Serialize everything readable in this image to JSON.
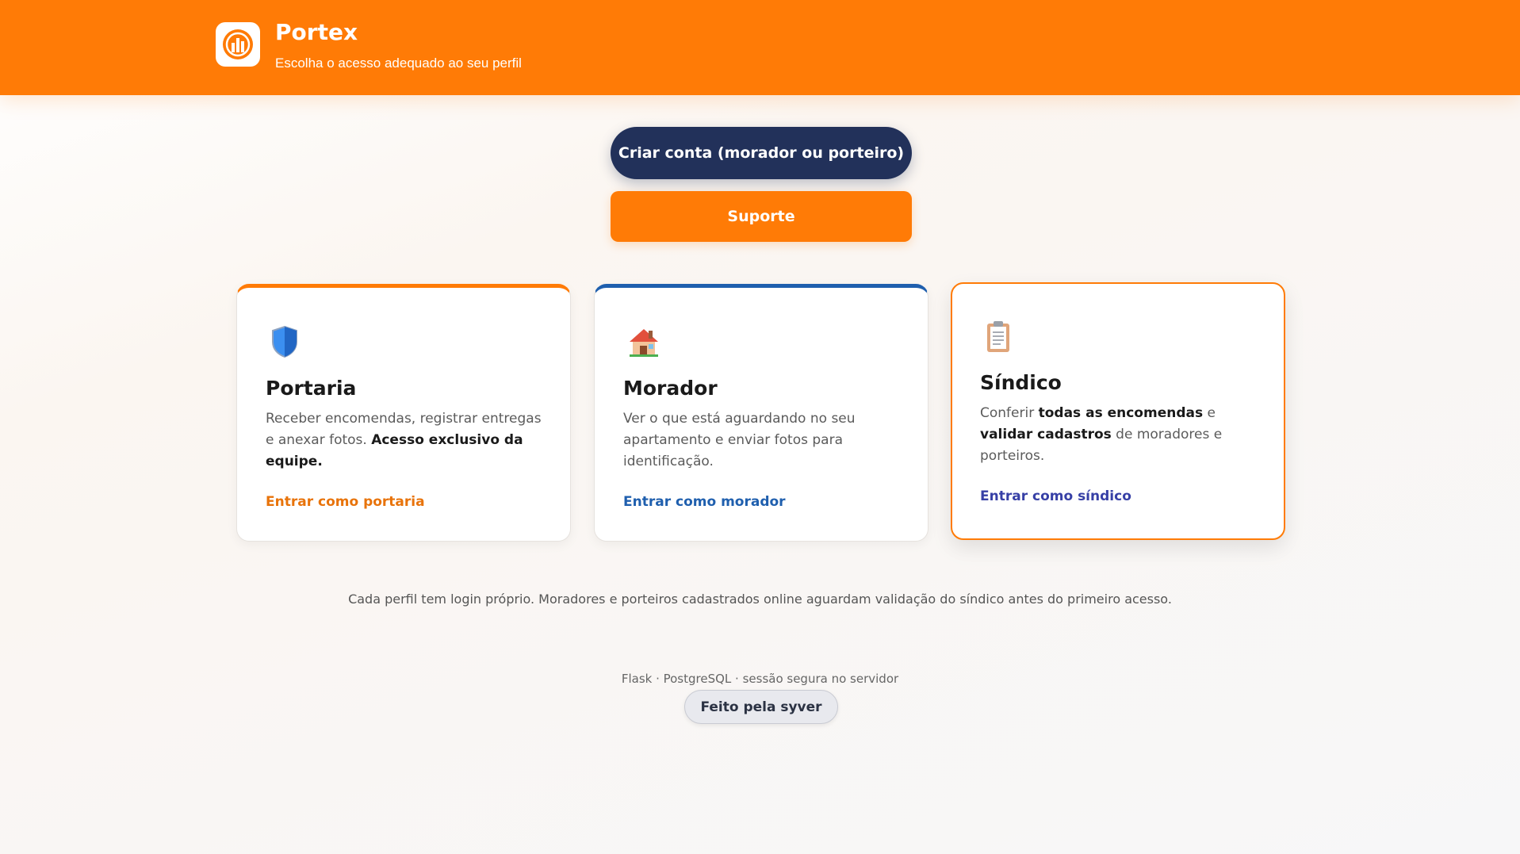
{
  "header": {
    "title": "Portex",
    "subtitle": "Escolha o acesso adequado ao seu perfil",
    "logo_icon": "building-logo-icon",
    "background_color": "#ff7b06"
  },
  "actions": {
    "create_account_label": "Criar conta (morador ou porteiro)",
    "support_label": "Suporte"
  },
  "cards": [
    {
      "id": "portaria",
      "icon": "shield-icon",
      "title": "Portaria",
      "desc_plain": "Receber encomendas, registrar entregas e anexar fotos. ",
      "desc_bold": "Acesso exclusivo da equipe.",
      "link": "Entrar como portaria",
      "accent": "#ff7b06"
    },
    {
      "id": "morador",
      "icon": "house-icon",
      "title": "Morador",
      "desc_plain": "Ver o que está aguardando no seu apartamento e enviar fotos para identificação.",
      "link": "Entrar como morador",
      "accent": "#1f5fae"
    },
    {
      "id": "sindico",
      "icon": "clipboard-icon",
      "title": "Síndico",
      "desc_1": "Conferir ",
      "desc_2": "todas as encomendas",
      "desc_3": " e ",
      "desc_4": "validar cadastros",
      "desc_5": " de moradores e porteiros.",
      "link": "Entrar como síndico",
      "accent": "#ff7b06"
    }
  ],
  "footer": {
    "note": "Cada perfil tem login próprio. Moradores e porteiros cadastrados online aguardam validação do síndico antes do primeiro acesso.",
    "tech": "Flask · PostgreSQL · sessão segura no servidor",
    "badge": "Feito pela syver"
  }
}
